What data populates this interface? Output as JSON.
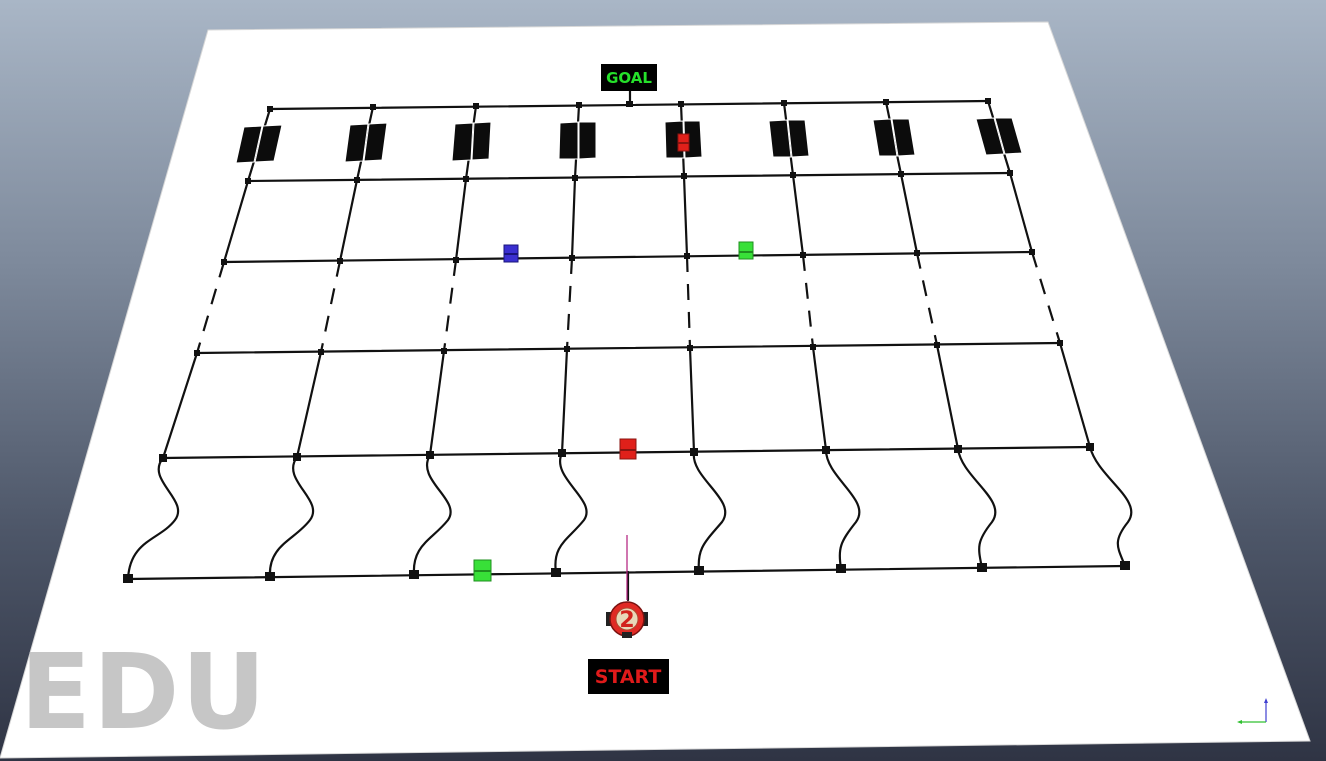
{
  "scene": {
    "goal_label": "GOAL",
    "start_label": "START",
    "robot_number": "2",
    "watermark": "EDU",
    "colors": {
      "board": "#ffffff",
      "line": "#111111",
      "goal_text": "#25e02a",
      "start_text": "#e01a1a",
      "label_bg": "#000000",
      "block_red": "#e0201a",
      "block_green": "#38e038",
      "block_blue": "#3a2fd0",
      "watermark": "#c6c6c6"
    },
    "objects": [
      {
        "type": "block",
        "color": "blue",
        "name": "blue-block"
      },
      {
        "type": "block",
        "color": "green",
        "name": "green-block-upper"
      },
      {
        "type": "block",
        "color": "red",
        "name": "red-block-middle"
      },
      {
        "type": "block",
        "color": "green",
        "name": "green-block-lower"
      },
      {
        "type": "block",
        "color": "red",
        "name": "red-block-top"
      }
    ]
  }
}
